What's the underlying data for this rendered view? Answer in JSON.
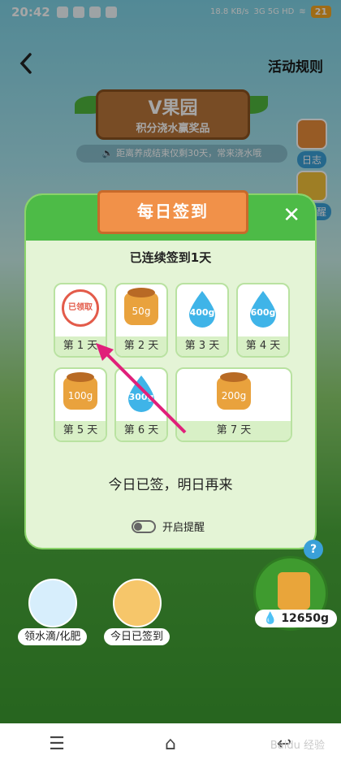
{
  "status_bar": {
    "time": "20:42",
    "network_speed": "18.8 KB/s",
    "network_type": "3G 5G HD",
    "battery": "21"
  },
  "nav": {
    "back_icon": "chevron-left-icon",
    "rules_label": "活动规则"
  },
  "banner": {
    "title": "V果园",
    "subtitle": "积分浇水赢奖品",
    "notice": "距离养成结束仅剩30天，常来浇水哦"
  },
  "side": {
    "log_label": "日志",
    "remind_label": "日提醒"
  },
  "modal": {
    "title": "每日签到",
    "streak_text": "已连续签到1天",
    "days": [
      {
        "label": "第 1 天",
        "reward": "已领取",
        "kind": "stamp"
      },
      {
        "label": "第 2 天",
        "reward": "50g",
        "kind": "fertilizer"
      },
      {
        "label": "第 3 天",
        "reward": "400g",
        "kind": "water"
      },
      {
        "label": "第 4 天",
        "reward": "600g",
        "kind": "water"
      },
      {
        "label": "第 5 天",
        "reward": "100g",
        "kind": "fertilizer"
      },
      {
        "label": "第 6 天",
        "reward": "300g",
        "kind": "water"
      },
      {
        "label": "第 7 天",
        "reward": "200g",
        "kind": "fertilizer"
      }
    ],
    "message": "今日已签，明日再来",
    "reminder_label": "开启提醒"
  },
  "bottom": {
    "water_fertilizer_label": "领水滴/化肥",
    "checkin_label": "今日已签到",
    "water_count": "12650g",
    "help_label": "?"
  },
  "colors": {
    "modal_green": "#4dbb47",
    "title_orange": "#f19149",
    "annotation_arrow": "#e0207a"
  },
  "watermark": "Baidu 经验"
}
